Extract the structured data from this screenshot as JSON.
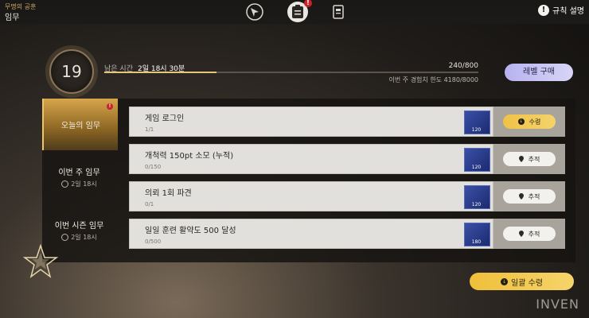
{
  "header": {
    "subtitle": "무명의 공훈",
    "title": "임무",
    "rules_label": "규칙 설명",
    "tab_alert": "!"
  },
  "level": {
    "value": "19",
    "remaining_label": "남은 시간",
    "remaining_value": "2일 18시 30분",
    "xp_text": "240/800",
    "xp_fraction": 0.3,
    "weekly_cap": "이번 주 경험치 한도 4180/8000",
    "buy_label": "레벨 구매"
  },
  "sidebar": {
    "items": [
      {
        "label": "오늘의 임무",
        "sub": "",
        "alert": "!"
      },
      {
        "label": "이번 주 임무",
        "sub": "2일 18시"
      },
      {
        "label": "이번 시즌 임무",
        "sub": "2일 18시"
      }
    ]
  },
  "quests": [
    {
      "name": "게임 로그인",
      "progress": "1/1",
      "reward": "120",
      "action": "수령",
      "action_type": "claim"
    },
    {
      "name": "개척력 150pt 소모 (누적)",
      "progress": "0/150",
      "reward": "120",
      "action": "추적",
      "action_type": "track"
    },
    {
      "name": "의뢰 1회 파견",
      "progress": "0/1",
      "reward": "120",
      "action": "추적",
      "action_type": "track"
    },
    {
      "name": "일일 훈련 활약도 500 달성",
      "progress": "0/500",
      "reward": "180",
      "action": "추적",
      "action_type": "track"
    }
  ],
  "claim_all_label": "일괄 수령",
  "watermark": "INVEN",
  "colors": {
    "accent_gold": "#efc246",
    "buy_button": "#c8c4f4",
    "alert_red": "#c8222a"
  },
  "icons": [
    "compass-icon",
    "clipboard-icon",
    "log-book-icon",
    "info-icon",
    "clock-icon",
    "pin-icon",
    "download-claim-icon",
    "reward-item-icon",
    "star-emblem-icon"
  ]
}
